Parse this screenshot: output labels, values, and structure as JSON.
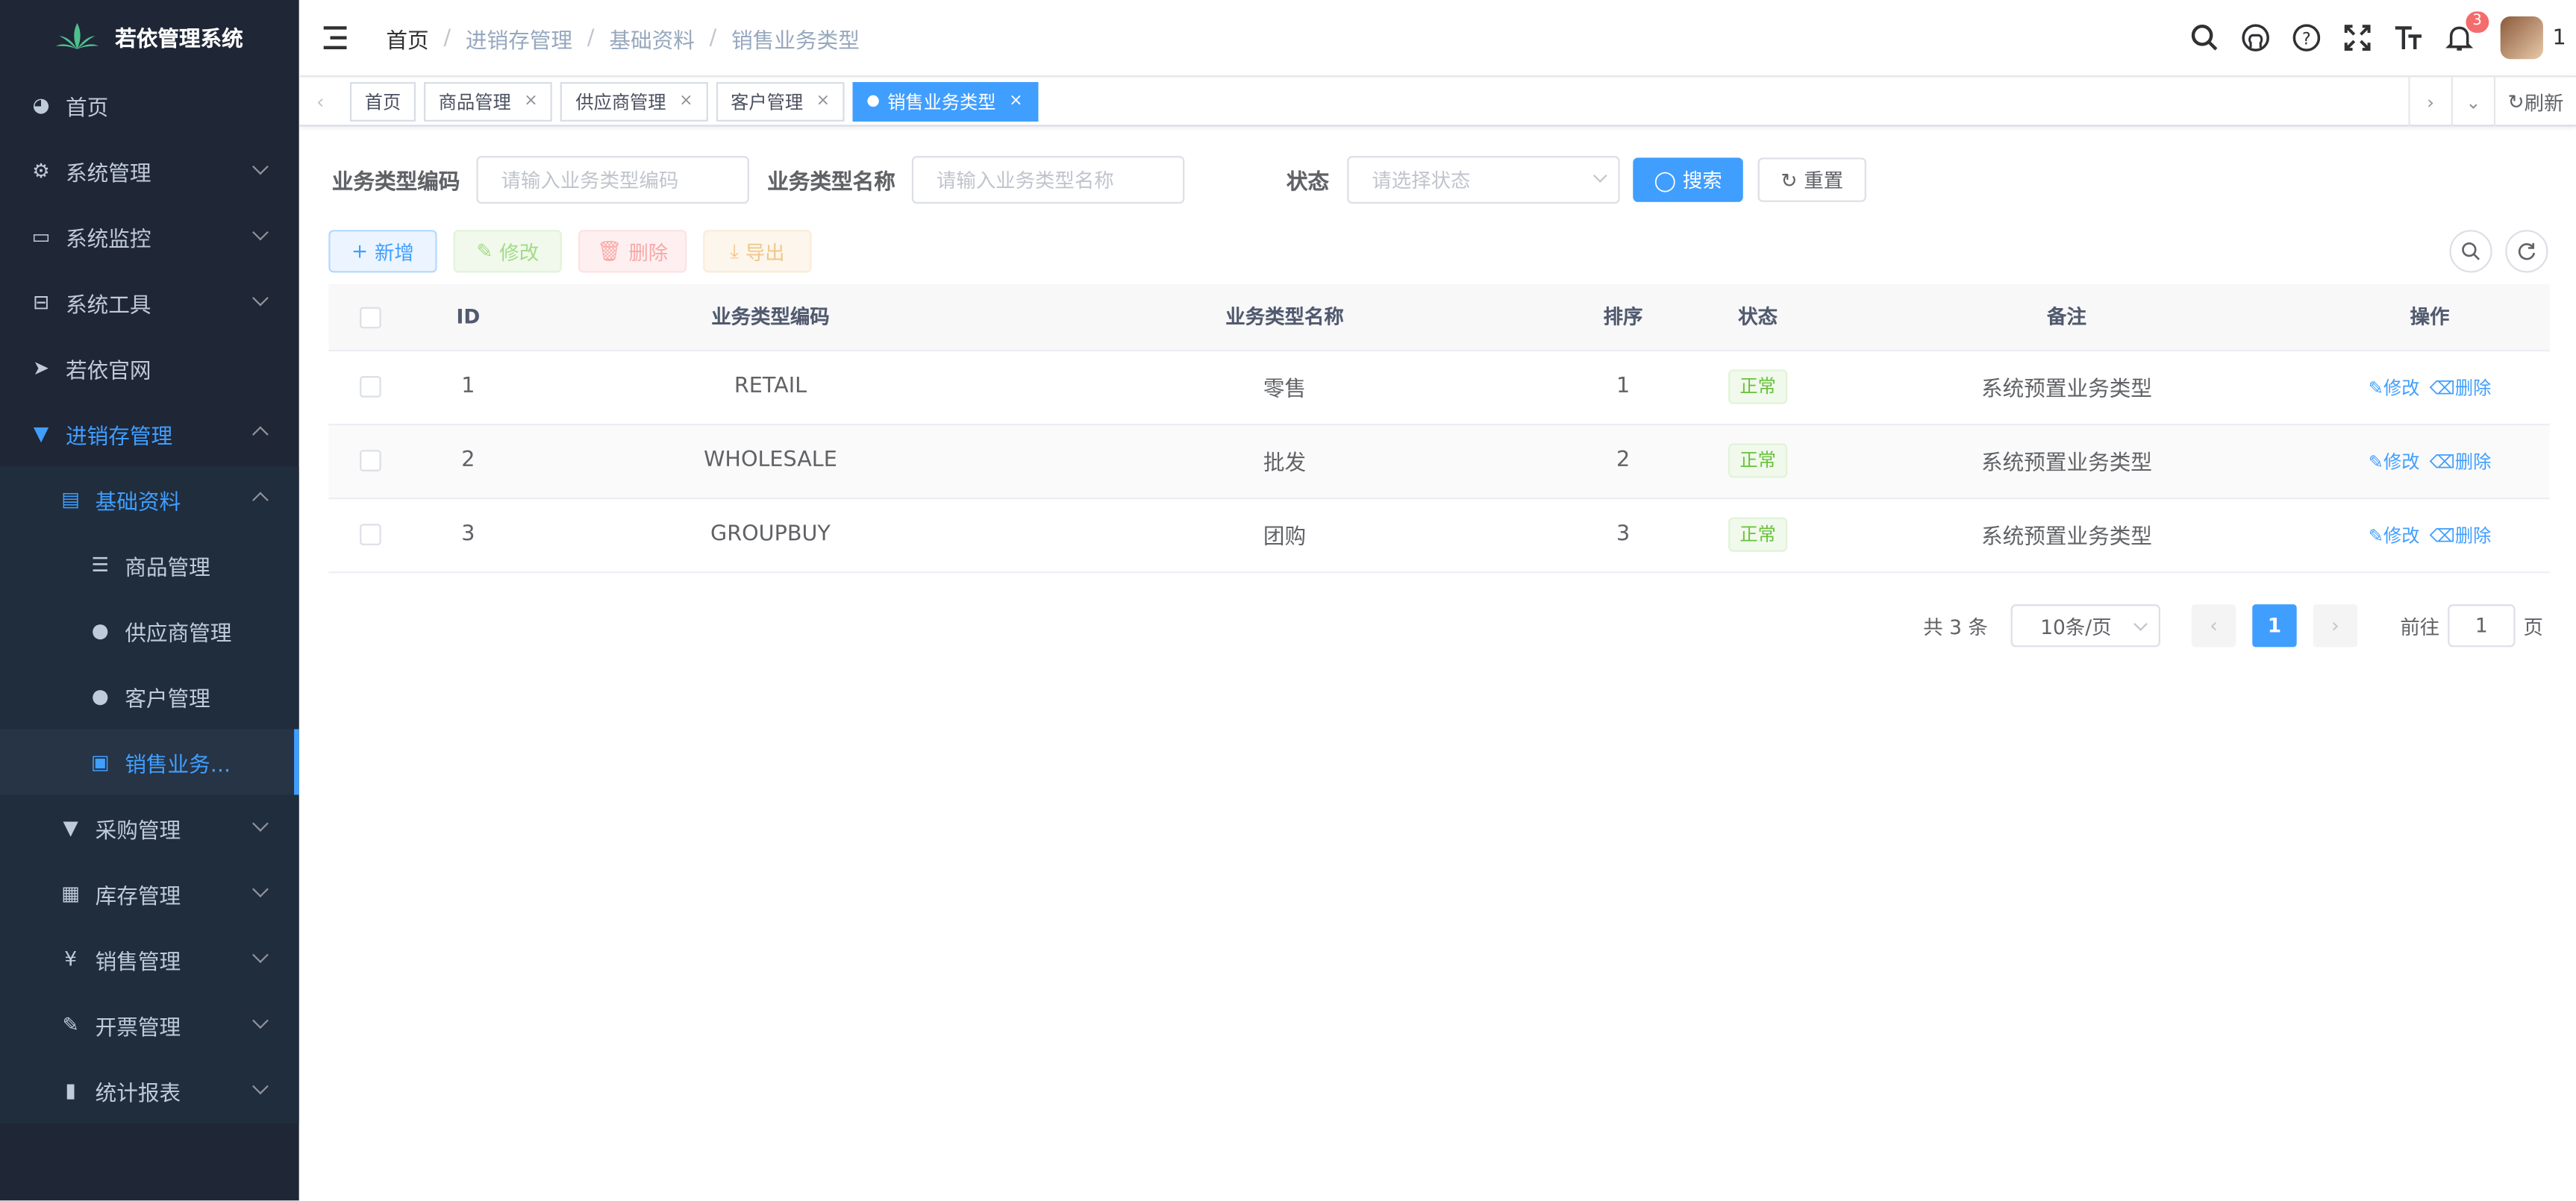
{
  "app": {
    "title": "若依管理系统"
  },
  "sidebar": {
    "items": [
      {
        "label": "首页"
      },
      {
        "label": "系统管理"
      },
      {
        "label": "系统监控"
      },
      {
        "label": "系统工具"
      },
      {
        "label": "若依官网"
      },
      {
        "label": "进销存管理"
      },
      {
        "label": "基础资料"
      },
      {
        "label": "商品管理"
      },
      {
        "label": "供应商管理"
      },
      {
        "label": "客户管理"
      },
      {
        "label": "销售业务..."
      },
      {
        "label": "采购管理"
      },
      {
        "label": "库存管理"
      },
      {
        "label": "销售管理"
      },
      {
        "label": "开票管理"
      },
      {
        "label": "统计报表"
      }
    ]
  },
  "breadcrumb": [
    "首页",
    "进销存管理",
    "基础资料",
    "销售业务类型"
  ],
  "header": {
    "notification_count": "3",
    "user_name": "1"
  },
  "tabs": [
    {
      "label": "首页"
    },
    {
      "label": "商品管理"
    },
    {
      "label": "供应商管理"
    },
    {
      "label": "客户管理"
    },
    {
      "label": "销售业务类型"
    }
  ],
  "tabs_refresh": "刷新",
  "search": {
    "code_label": "业务类型编码",
    "code_placeholder": "请输入业务类型编码",
    "name_label": "业务类型名称",
    "name_placeholder": "请输入业务类型名称",
    "status_label": "状态",
    "status_placeholder": "请选择状态",
    "search_btn": "搜索",
    "reset_btn": "重置"
  },
  "toolbar": {
    "add": "新增",
    "edit": "修改",
    "delete": "删除",
    "export": "导出"
  },
  "table": {
    "columns": [
      "ID",
      "业务类型编码",
      "业务类型名称",
      "排序",
      "状态",
      "备注",
      "操作"
    ],
    "rows": [
      {
        "id": "1",
        "code": "RETAIL",
        "name": "零售",
        "sort": "1",
        "status": "正常",
        "remark": "系统预置业务类型"
      },
      {
        "id": "2",
        "code": "WHOLESALE",
        "name": "批发",
        "sort": "2",
        "status": "正常",
        "remark": "系统预置业务类型"
      },
      {
        "id": "3",
        "code": "GROUPBUY",
        "name": "团购",
        "sort": "3",
        "status": "正常",
        "remark": "系统预置业务类型"
      }
    ],
    "op_edit": "修改",
    "op_delete": "删除"
  },
  "pagination": {
    "total": "共 3 条",
    "page_size": "10条/页",
    "current": "1",
    "goto_label": "前往",
    "goto_value": "1",
    "page_unit": "页"
  },
  "colors": {
    "primary": "#409eff",
    "sidebar_bg": "#1f2636",
    "success": "#67c23a",
    "danger": "#f56c6c",
    "warning": "#e6a23c"
  }
}
